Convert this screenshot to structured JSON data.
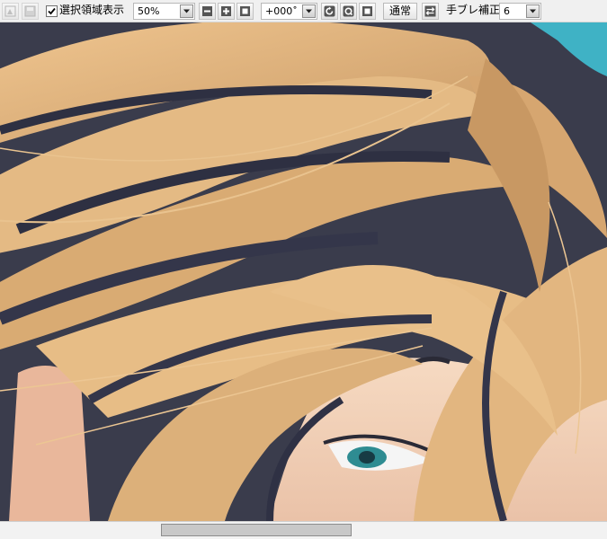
{
  "toolbar": {
    "show_selection_checked": true,
    "show_selection_label": "選択領域表示",
    "zoom_value": "50%",
    "rotation_value": "+000˚",
    "blend_mode_label": "通常",
    "stabilizer_label": "手ブレ補正",
    "stabilizer_value": "6"
  },
  "colors": {
    "toolbar_bg": "#f0f0f0",
    "canvas_bg_accent": "#3fb2c5",
    "hair_light": "#e4ba84",
    "hair_dark": "#3a3c4c",
    "eye": "#2e8c92"
  },
  "icons": [
    "new-canvas-icon",
    "save-icon",
    "checkbox-check-icon",
    "dropdown-arrow-icon",
    "zoom-out-icon",
    "zoom-in-icon",
    "zoom-reset-icon",
    "rotate-icon",
    "rotate-reset-icon",
    "stop-icon",
    "flip-icon"
  ]
}
